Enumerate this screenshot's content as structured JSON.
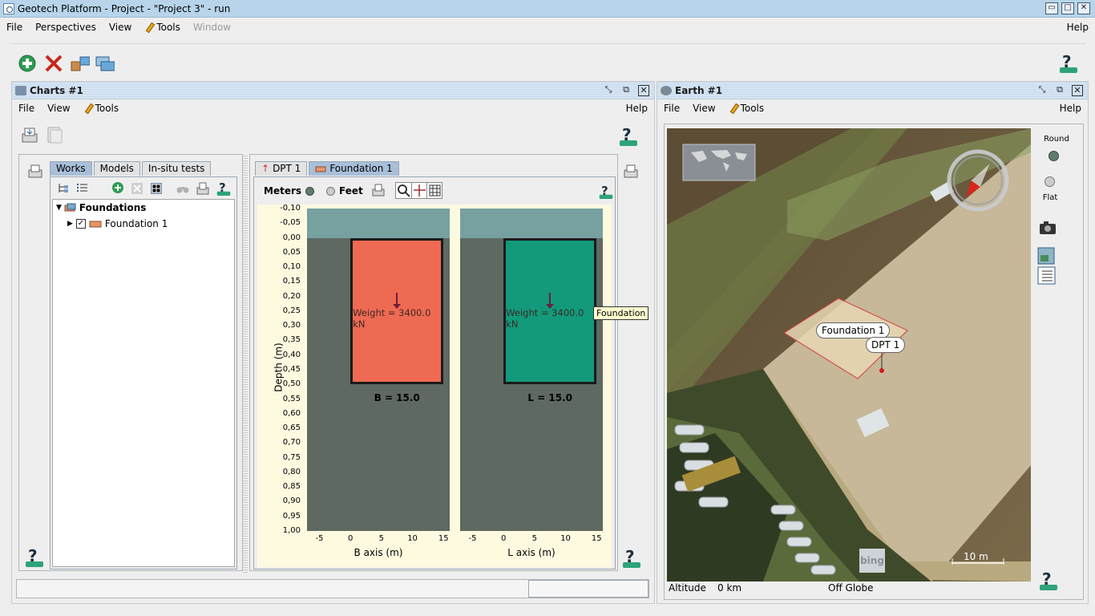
{
  "window": {
    "title": "Geotech Platform - Project - \"Project 3\" - run"
  },
  "menu": {
    "items": [
      "File",
      "Perspectives",
      "View",
      "Tools"
    ],
    "window_label": "Window",
    "help": "Help"
  },
  "charts_panel": {
    "title": "Charts #1",
    "menu": {
      "file": "File",
      "view": "View",
      "tools": "Tools",
      "help": "Help"
    },
    "tree_tabs": [
      "Works",
      "Models",
      "In-situ tests"
    ],
    "tree": {
      "root": "Foundations",
      "child": "Foundation 1"
    },
    "chart_tabs": [
      "DPT 1",
      "Foundation 1"
    ],
    "units": {
      "meters": "Meters",
      "feet": "Feet"
    },
    "tooltip": "Foundation"
  },
  "chart_data": {
    "type": "bar",
    "ylabel": "Depth (m)",
    "ylim": [
      -0.1,
      1.0
    ],
    "yticks": [
      "-0,10",
      "-0,05",
      "0,00",
      "0,05",
      "0,10",
      "0,15",
      "0,20",
      "0,25",
      "0,30",
      "0,35",
      "0,40",
      "0,45",
      "0,50",
      "0,55",
      "0,60",
      "0,65",
      "0,70",
      "0,75",
      "0,80",
      "0,85",
      "0,90",
      "0,95",
      "1,00"
    ],
    "soil_surface_depth": 0.0,
    "plots": [
      {
        "xlabel": "B axis (m)",
        "xticks": [
          "-5",
          "0",
          "5",
          "10",
          "15"
        ],
        "xlim": [
          -7,
          16
        ],
        "foundation": {
          "x_start": 0,
          "x_end": 15,
          "depth_top": 0.0,
          "depth_bottom": 0.5,
          "color": "#ef6a52"
        },
        "load_label": "Weight = 3400.0 kN",
        "dimension_label": "B = 15.0"
      },
      {
        "xlabel": "L axis (m)",
        "xticks": [
          "-5",
          "0",
          "5",
          "10",
          "15"
        ],
        "xlim": [
          -7,
          16
        ],
        "foundation": {
          "x_start": 0,
          "x_end": 15,
          "depth_top": 0.0,
          "depth_bottom": 0.5,
          "color": "#129a7a"
        },
        "load_label": "Weight = 3400.0 kN",
        "dimension_label": "L = 15.0"
      }
    ]
  },
  "earth_panel": {
    "title": "Earth #1",
    "menu": {
      "file": "File",
      "view": "View",
      "tools": "Tools",
      "help": "Help"
    },
    "labels": {
      "foundation": "Foundation 1",
      "dpt": "DPT 1"
    },
    "mode_round": "Round",
    "mode_flat": "Flat",
    "scale": "10 m",
    "bing": "bing",
    "status": {
      "altitude_label": "Altitude",
      "altitude_value": "0 km",
      "globe": "Off Globe"
    }
  },
  "colors": {
    "title_bar": "#b7d4ea",
    "accent_green": "#2ea37a",
    "soil": "#77a0a0",
    "ground": "#5e6962"
  }
}
